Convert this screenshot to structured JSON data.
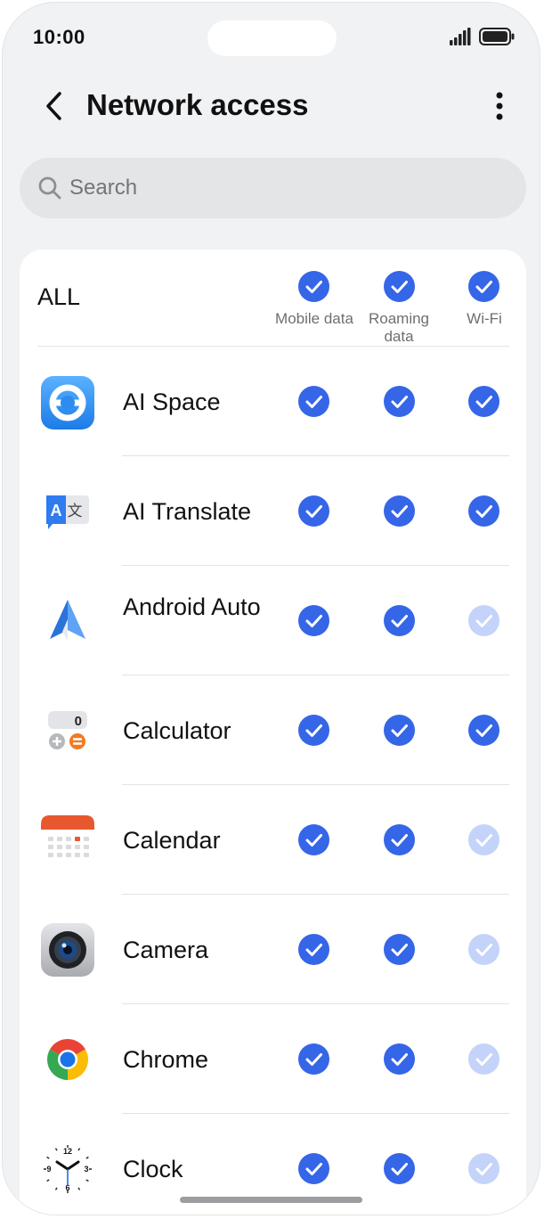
{
  "status_bar": {
    "time": "10:00"
  },
  "header": {
    "title": "Network access"
  },
  "search": {
    "placeholder": "Search"
  },
  "columns": {
    "mobile": "Mobile data",
    "roaming": "Roaming data",
    "wifi": "Wi-Fi"
  },
  "all": {
    "label": "ALL",
    "mobile": true,
    "roaming": true,
    "wifi": true
  },
  "apps": [
    {
      "name": "AI Space",
      "icon": "ai-space-icon",
      "mobile": true,
      "roaming": true,
      "wifi": true
    },
    {
      "name": "AI Translate",
      "icon": "ai-translate-icon",
      "mobile": true,
      "roaming": true,
      "wifi": true
    },
    {
      "name": "Android Auto",
      "icon": "android-auto-icon",
      "mobile": true,
      "roaming": true,
      "wifi": false
    },
    {
      "name": "Calculator",
      "icon": "calculator-icon",
      "mobile": true,
      "roaming": true,
      "wifi": true
    },
    {
      "name": "Calendar",
      "icon": "calendar-icon",
      "mobile": true,
      "roaming": true,
      "wifi": false
    },
    {
      "name": "Camera",
      "icon": "camera-icon",
      "mobile": true,
      "roaming": true,
      "wifi": false
    },
    {
      "name": "Chrome",
      "icon": "chrome-icon",
      "mobile": true,
      "roaming": true,
      "wifi": false
    },
    {
      "name": "Clock",
      "icon": "clock-icon",
      "mobile": true,
      "roaming": true,
      "wifi": false
    }
  ],
  "colors": {
    "accent": "#3566e8",
    "accent_disabled": "#c4d3f9",
    "background": "#f1f2f4"
  }
}
